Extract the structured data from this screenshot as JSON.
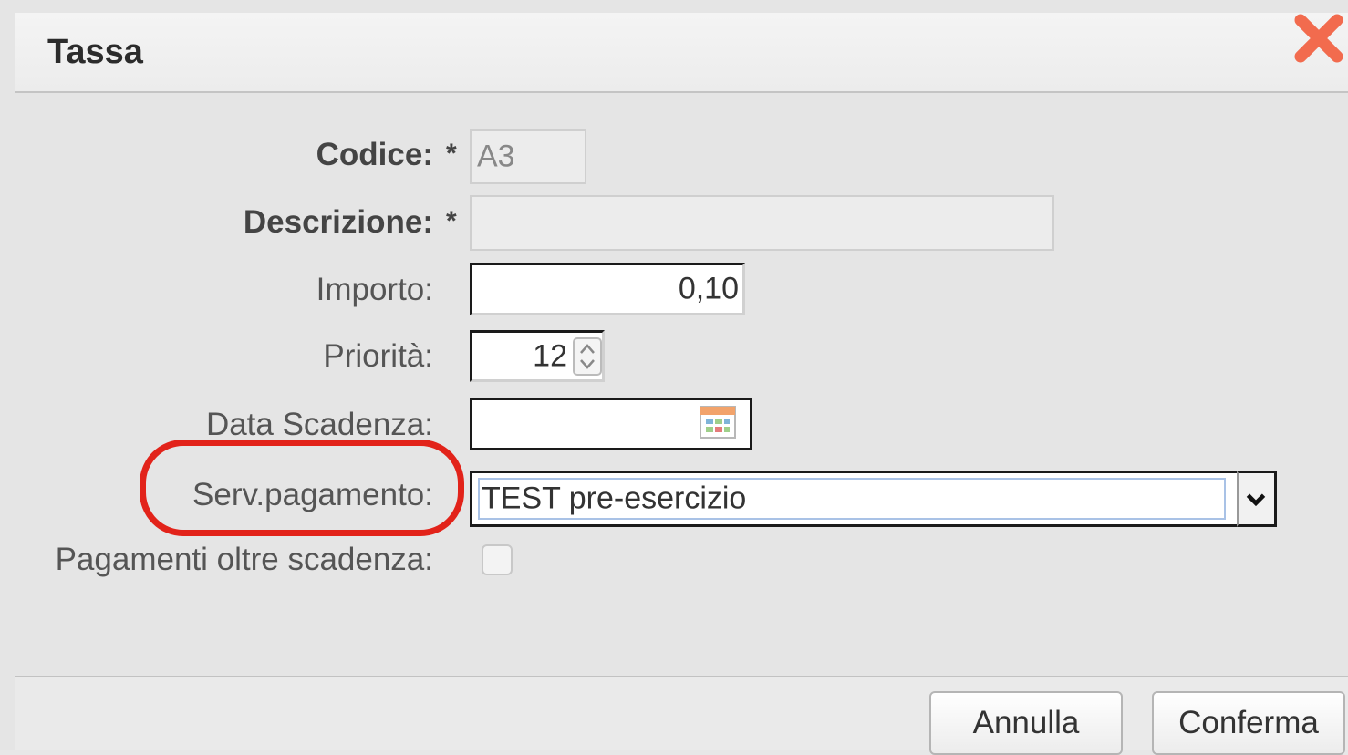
{
  "dialog": {
    "title": "Tassa"
  },
  "form": {
    "codice": {
      "label": "Codice:",
      "required": "*",
      "value": "A3"
    },
    "descrizione": {
      "label": "Descrizione:",
      "required": "*",
      "value": ""
    },
    "importo": {
      "label": "Importo:",
      "value": "0,10"
    },
    "priorita": {
      "label": "Priorità:",
      "value": "12"
    },
    "data_scadenza": {
      "label": "Data Scadenza:",
      "value": ""
    },
    "serv_pagamento": {
      "label": "Serv.pagamento:",
      "value": "TEST pre-esercizio"
    },
    "pagamenti_oltre": {
      "label": "Pagamenti oltre scadenza:",
      "checked": false
    }
  },
  "buttons": {
    "annulla": "Annulla",
    "conferma": "Conferma"
  },
  "colors": {
    "highlight": "#e2231a",
    "close": "#f26b4e"
  }
}
